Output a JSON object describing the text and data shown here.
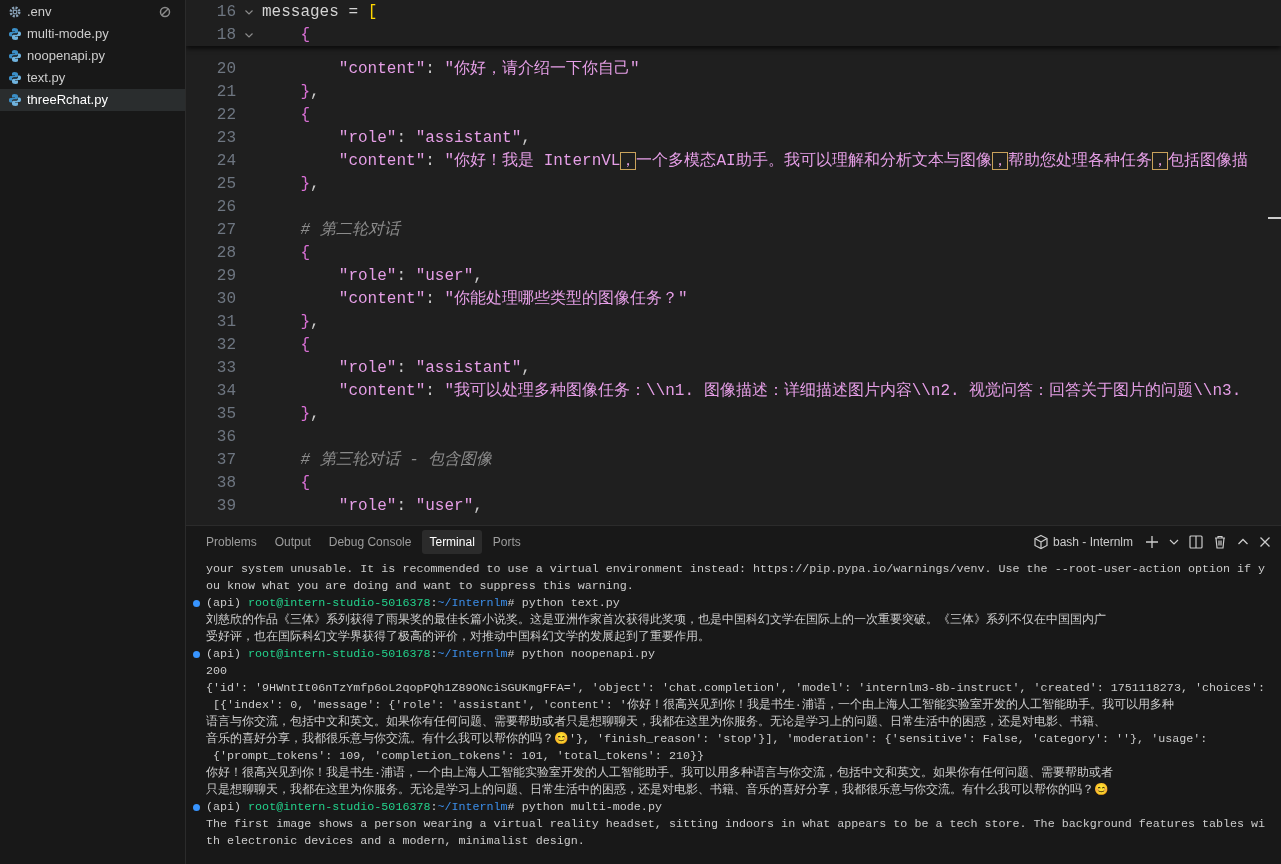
{
  "sidebar": {
    "files": [
      {
        "name": ".env",
        "kind": "settings",
        "ignored": true,
        "selected": false
      },
      {
        "name": "multi-mode.py",
        "kind": "python",
        "ignored": false,
        "selected": false
      },
      {
        "name": "noopenapi.py",
        "kind": "python",
        "ignored": false,
        "selected": false
      },
      {
        "name": "text.py",
        "kind": "python",
        "ignored": false,
        "selected": false
      },
      {
        "name": "threeRchat.py",
        "kind": "python",
        "ignored": false,
        "selected": true
      }
    ]
  },
  "editor": {
    "sticky_lines": [
      {
        "number": "16",
        "tokens": [
          {
            "kind": "plain",
            "text": "messages = "
          },
          {
            "kind": "bracket",
            "text": "["
          }
        ]
      },
      {
        "number": "18",
        "tokens": [
          {
            "kind": "brace",
            "text": "    {"
          }
        ]
      }
    ],
    "lines": [
      {
        "number": "20",
        "tokens": [
          {
            "kind": "string",
            "text": "        \"content\""
          },
          {
            "kind": "punct",
            "text": ": "
          },
          {
            "kind": "string",
            "text": "\"你好，请介绍一下你自己\""
          }
        ]
      },
      {
        "number": "21",
        "tokens": [
          {
            "kind": "brace",
            "text": "    }"
          },
          {
            "kind": "punct",
            "text": ","
          }
        ]
      },
      {
        "number": "22",
        "tokens": [
          {
            "kind": "brace",
            "text": "    {"
          }
        ]
      },
      {
        "number": "23",
        "tokens": [
          {
            "kind": "string",
            "text": "        \"role\""
          },
          {
            "kind": "punct",
            "text": ": "
          },
          {
            "kind": "string",
            "text": "\"assistant\""
          },
          {
            "kind": "punct",
            "text": ","
          }
        ]
      },
      {
        "number": "24",
        "tokens": [
          {
            "kind": "string",
            "text": "        \"content\""
          },
          {
            "kind": "punct",
            "text": ": "
          },
          {
            "kind": "string",
            "text": "\"你好！我是 InternVL"
          },
          {
            "kind": "highlight",
            "text": "，"
          },
          {
            "kind": "string",
            "text": "一个多模态AI助手。我可以理解和分析文本与图像"
          },
          {
            "kind": "highlight",
            "text": "，"
          },
          {
            "kind": "string",
            "text": "帮助您处理各种任务"
          },
          {
            "kind": "highlight",
            "text": "，"
          },
          {
            "kind": "string",
            "text": "包括图像描"
          }
        ]
      },
      {
        "number": "25",
        "tokens": [
          {
            "kind": "brace",
            "text": "    }"
          },
          {
            "kind": "punct",
            "text": ","
          }
        ]
      },
      {
        "number": "26"
      },
      {
        "number": "27",
        "tokens": [
          {
            "kind": "comment",
            "text": "    # 第二轮对话"
          }
        ]
      },
      {
        "number": "28",
        "tokens": [
          {
            "kind": "brace",
            "text": "    {"
          }
        ]
      },
      {
        "number": "29",
        "tokens": [
          {
            "kind": "string",
            "text": "        \"role\""
          },
          {
            "kind": "punct",
            "text": ": "
          },
          {
            "kind": "string",
            "text": "\"user\""
          },
          {
            "kind": "punct",
            "text": ","
          }
        ]
      },
      {
        "number": "30",
        "tokens": [
          {
            "kind": "string",
            "text": "        \"content\""
          },
          {
            "kind": "punct",
            "text": ": "
          },
          {
            "kind": "string",
            "text": "\"你能处理哪些类型的图像任务？\""
          }
        ]
      },
      {
        "number": "31",
        "tokens": [
          {
            "kind": "brace",
            "text": "    }"
          },
          {
            "kind": "punct",
            "text": ","
          }
        ]
      },
      {
        "number": "32",
        "tokens": [
          {
            "kind": "brace",
            "text": "    {"
          }
        ]
      },
      {
        "number": "33",
        "tokens": [
          {
            "kind": "string",
            "text": "        \"role\""
          },
          {
            "kind": "punct",
            "text": ": "
          },
          {
            "kind": "string",
            "text": "\"assistant\""
          },
          {
            "kind": "punct",
            "text": ","
          }
        ]
      },
      {
        "number": "34",
        "tokens": [
          {
            "kind": "string",
            "text": "        \"content\""
          },
          {
            "kind": "punct",
            "text": ": "
          },
          {
            "kind": "string",
            "text": "\"我可以处理多种图像任务：\\\\n1. 图像描述：详细描述图片内容\\\\n2. 视觉问答：回答关于图片的问题\\\\n3."
          }
        ]
      },
      {
        "number": "35",
        "tokens": [
          {
            "kind": "brace",
            "text": "    }"
          },
          {
            "kind": "punct",
            "text": ","
          }
        ]
      },
      {
        "number": "36"
      },
      {
        "number": "37",
        "tokens": [
          {
            "kind": "comment",
            "text": "    # 第三轮对话 - 包含图像"
          }
        ]
      },
      {
        "number": "38",
        "tokens": [
          {
            "kind": "brace",
            "text": "    {"
          }
        ]
      },
      {
        "number": "39",
        "tokens": [
          {
            "kind": "string",
            "text": "        \"role\""
          },
          {
            "kind": "punct",
            "text": ": "
          },
          {
            "kind": "string",
            "text": "\"user\""
          },
          {
            "kind": "punct",
            "text": ","
          }
        ]
      }
    ]
  },
  "panel": {
    "tabs": [
      {
        "label": "Problems",
        "selected": false
      },
      {
        "label": "Output",
        "selected": false
      },
      {
        "label": "Debug Console",
        "selected": false
      },
      {
        "label": "Terminal",
        "selected": true
      },
      {
        "label": "Ports",
        "selected": false
      }
    ],
    "terminal_name": "bash - Internlm",
    "terminal_lines": [
      {
        "kind": "output",
        "text": "your system unusable. It is recommended to use a virtual environment instead: https://pip.pypa.io/warnings/venv. Use the --root-user-action option if y"
      },
      {
        "kind": "output",
        "text": "ou know what you are doing and want to suppress this warning."
      },
      {
        "kind": "prompt",
        "env": "(api)",
        "user_host": "root@intern-studio-5016378",
        "separator": ":",
        "path": "~/Internlm",
        "command": "# python text.py"
      },
      {
        "kind": "output",
        "text": "刘慈欣的作品《三体》系列获得了雨果奖的最佳长篇小说奖。这是亚洲作家首次获得此奖项，也是中国科幻文学在国际上的一次重要突破。《三体》系列不仅在中国国内广"
      },
      {
        "kind": "output",
        "text": "受好评，也在国际科幻文学界获得了极高的评价，对推动中国科幻文学的发展起到了重要作用。"
      },
      {
        "kind": "prompt",
        "env": "(api)",
        "user_host": "root@intern-studio-5016378",
        "separator": ":",
        "path": "~/Internlm",
        "command": "# python noopenapi.py"
      },
      {
        "kind": "output",
        "text": "200"
      },
      {
        "kind": "output",
        "text": "{'id': '9HWntIt06nTzYmfp6oL2qopPQh1Z89ONciSGUKmgFFA=', 'object': 'chat.completion', 'model': 'internlm3-8b-instruct', 'created': 1751118273, 'choices':"
      },
      {
        "kind": "output",
        "text": " [{'index': 0, 'message': {'role': 'assistant', 'content': '你好！很高兴见到你！我是书生·浦语，一个由上海人工智能实验室开发的人工智能助手。我可以用多种"
      },
      {
        "kind": "output",
        "text": "语言与你交流，包括中文和英文。如果你有任何问题、需要帮助或者只是想聊聊天，我都在这里为你服务。无论是学习上的问题、日常生活中的困惑，还是对电影、书籍、"
      },
      {
        "kind": "output",
        "text": "音乐的喜好分享，我都很乐意与你交流。有什么我可以帮你的吗？😊'}, 'finish_reason': 'stop'}], 'moderation': {'sensitive': False, 'category': ''}, 'usage':"
      },
      {
        "kind": "output",
        "text": " {'prompt_tokens': 109, 'completion_tokens': 101, 'total_tokens': 210}}"
      },
      {
        "kind": "output",
        "text": "你好！很高兴见到你！我是书生·浦语，一个由上海人工智能实验室开发的人工智能助手。我可以用多种语言与你交流，包括中文和英文。如果你有任何问题、需要帮助或者"
      },
      {
        "kind": "output",
        "text": "只是想聊聊天，我都在这里为你服务。无论是学习上的问题、日常生活中的困惑，还是对电影、书籍、音乐的喜好分享，我都很乐意与你交流。有什么我可以帮你的吗？😊"
      },
      {
        "kind": "prompt",
        "env": "(api)",
        "user_host": "root@intern-studio-5016378",
        "separator": ":",
        "path": "~/Internlm",
        "command": "# python multi-mode.py"
      },
      {
        "kind": "output",
        "text": "The first image shows a person wearing a virtual reality headset, sitting indoors in what appears to be a tech store. The background features tables wi"
      },
      {
        "kind": "output",
        "text": "th electronic devices and a modern, minimalist design."
      }
    ]
  }
}
